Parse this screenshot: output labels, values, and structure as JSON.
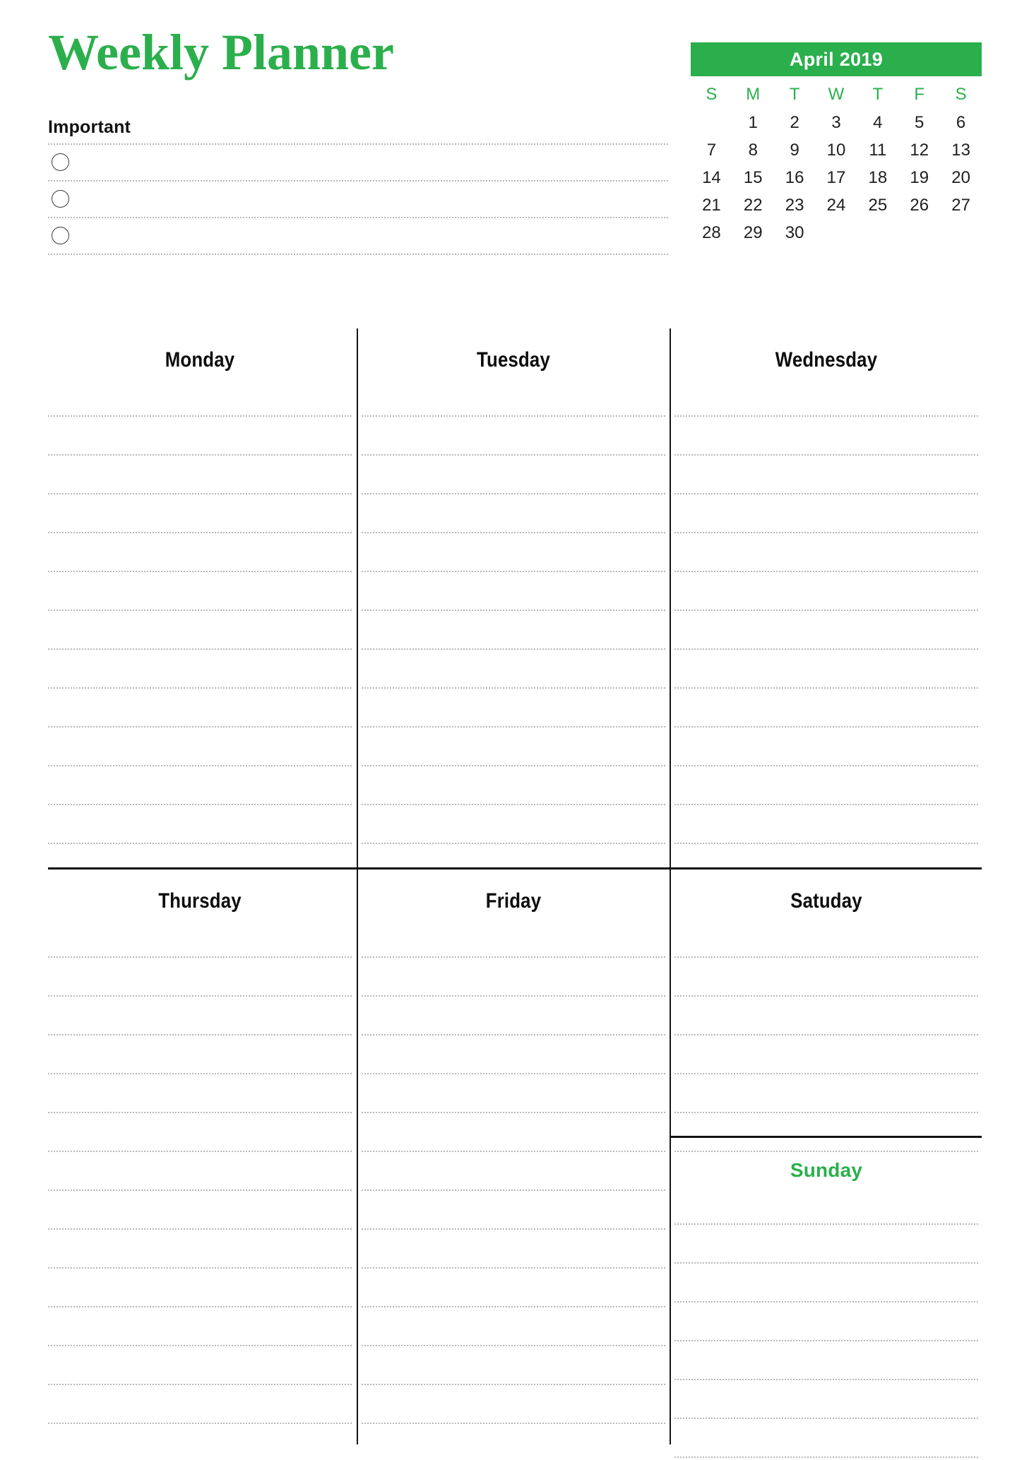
{
  "title": "Weekly Planner",
  "accent_color": "#2BAF4C",
  "important": {
    "heading": "Important",
    "rows": [
      {
        "checkbox": "circle-checkbox",
        "value": ""
      },
      {
        "checkbox": "circle-checkbox",
        "value": ""
      },
      {
        "checkbox": "circle-checkbox",
        "value": ""
      }
    ]
  },
  "calendar": {
    "month_year": "April 2019",
    "day_initials": [
      "S",
      "M",
      "T",
      "W",
      "T",
      "F",
      "S"
    ],
    "weeks": [
      [
        "",
        "1",
        "2",
        "3",
        "4",
        "5",
        "6"
      ],
      [
        "7",
        "8",
        "9",
        "10",
        "11",
        "12",
        "13"
      ],
      [
        "14",
        "15",
        "16",
        "17",
        "18",
        "19",
        "20"
      ],
      [
        "21",
        "22",
        "23",
        "24",
        "25",
        "26",
        "27"
      ],
      [
        "28",
        "29",
        "30",
        "",
        "",
        "",
        ""
      ]
    ]
  },
  "days": {
    "monday": {
      "label": "Monday",
      "line_count": 12,
      "value": ""
    },
    "tuesday": {
      "label": "Tuesday",
      "line_count": 12,
      "value": ""
    },
    "wednesday": {
      "label": "Wednesday",
      "line_count": 12,
      "value": ""
    },
    "thursday": {
      "label": "Thursday",
      "line_count": 13,
      "value": ""
    },
    "friday": {
      "label": "Friday",
      "line_count": 13,
      "value": ""
    },
    "saturday": {
      "label": "Satuday",
      "line_count": 6,
      "value": ""
    },
    "sunday": {
      "label": "Sunday",
      "line_count": 7,
      "value": ""
    }
  }
}
